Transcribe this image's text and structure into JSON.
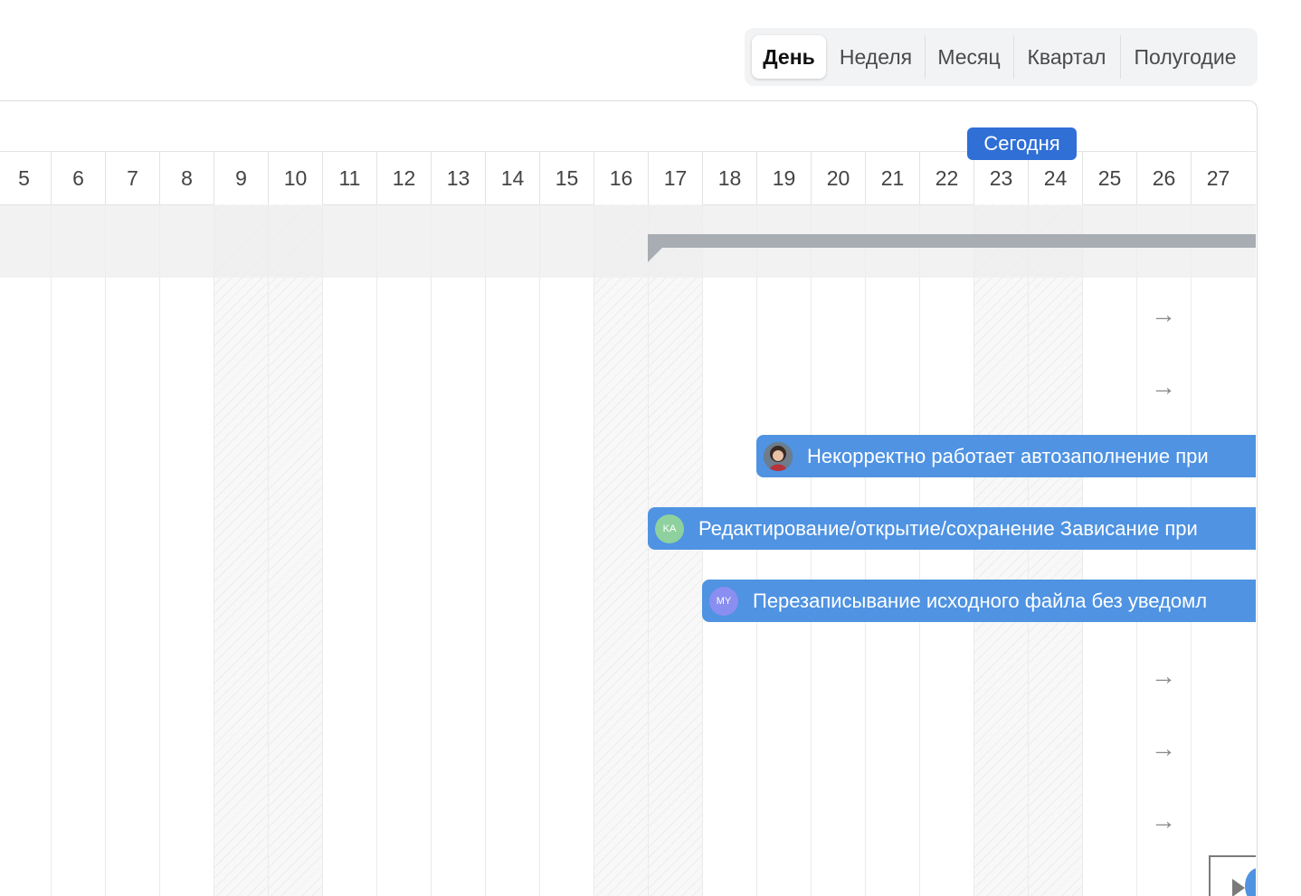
{
  "view_switcher": {
    "options": [
      "День",
      "Неделя",
      "Месяц",
      "Квартал",
      "Полугодие"
    ],
    "selected": "День"
  },
  "timeline": {
    "days": [
      "5",
      "6",
      "7",
      "8",
      "9",
      "10",
      "11",
      "12",
      "13",
      "14",
      "15",
      "16",
      "17",
      "18",
      "19",
      "20",
      "21",
      "22",
      "23",
      "24",
      "25",
      "26",
      "27"
    ],
    "weekend_days": [
      "9",
      "10",
      "16",
      "17",
      "23",
      "24"
    ],
    "today_label": "Сегодня",
    "today_day": "23"
  },
  "rows": {
    "scroll_arrow_symbol": "→"
  },
  "tasks": [
    {
      "title": "Некорректно работает автозаполнение при",
      "avatar_initials": "",
      "avatar_icon": "user-photo-icon",
      "start_day": "19",
      "avatar_color": "#5b6b7c"
    },
    {
      "title": "Редактирование/открытие/сохранение Зависание при",
      "avatar_initials": "KA",
      "avatar_icon": "initials-avatar",
      "start_day": "17",
      "avatar_color": "#8fd19e"
    },
    {
      "title": "Перезаписывание исходного файла без уведомл",
      "avatar_initials": "MY",
      "avatar_icon": "initials-avatar",
      "start_day": "18",
      "avatar_color": "#8a8ef0"
    }
  ],
  "colors": {
    "accent": "#2f6fd6",
    "task_bar": "#4f93e2",
    "summary_bar": "#a8adb3"
  }
}
